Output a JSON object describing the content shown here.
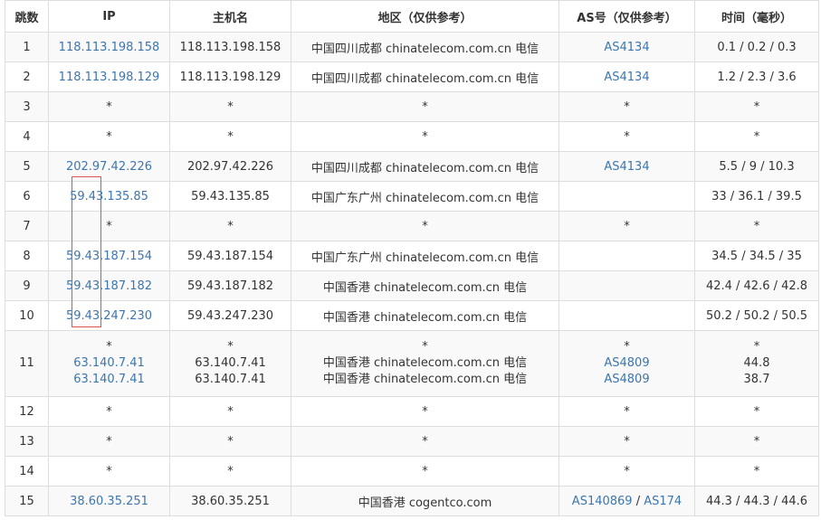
{
  "headers": [
    "跳数",
    "IP",
    "主机名",
    "地区（仅供参考）",
    "AS号（仅供参考）",
    "时间（毫秒）"
  ],
  "rows": [
    {
      "hop": "1",
      "ip": "118.113.198.158",
      "host": "118.113.198.158",
      "region": "中国四川成都 chinatelecom.com.cn 电信",
      "as": "AS4134",
      "time": "0.1 / 0.2 / 0.3"
    },
    {
      "hop": "2",
      "ip": "118.113.198.129",
      "host": "118.113.198.129",
      "region": "中国四川成都 chinatelecom.com.cn 电信",
      "as": "AS4134",
      "time": "1.2 / 2.3 / 3.6"
    },
    {
      "hop": "3",
      "ip": "*",
      "host": "*",
      "region": "*",
      "as": "*",
      "time": "*"
    },
    {
      "hop": "4",
      "ip": "*",
      "host": "*",
      "region": "*",
      "as": "*",
      "time": "*"
    },
    {
      "hop": "5",
      "ip": "202.97.42.226",
      "host": "202.97.42.226",
      "region": "中国四川成都 chinatelecom.com.cn 电信",
      "as": "AS4134",
      "time": "5.5 / 9 / 10.3"
    },
    {
      "hop": "6",
      "ip": "59.43.135.85",
      "host": "59.43.135.85",
      "region": "中国广东广州 chinatelecom.com.cn 电信",
      "as": "",
      "time": "33 / 36.1 / 39.5"
    },
    {
      "hop": "7",
      "ip": "*",
      "host": "*",
      "region": "*",
      "as": "*",
      "time": "*"
    },
    {
      "hop": "8",
      "ip": "59.43.187.154",
      "host": "59.43.187.154",
      "region": "中国广东广州 chinatelecom.com.cn 电信",
      "as": "",
      "time": "34.5 / 34.5 / 35"
    },
    {
      "hop": "9",
      "ip": "59.43.187.182",
      "host": "59.43.187.182",
      "region": "中国香港 chinatelecom.com.cn 电信",
      "as": "",
      "time": "42.4 / 42.6 / 42.8"
    },
    {
      "hop": "10",
      "ip": "59.43.247.230",
      "host": "59.43.247.230",
      "region": "中国香港 chinatelecom.com.cn 电信",
      "as": "",
      "time": "50.2 / 50.2 / 50.5"
    },
    {
      "hop": "11",
      "ip": [
        "*",
        "63.140.7.41",
        "63.140.7.41"
      ],
      "host": [
        "*",
        "63.140.7.41",
        "63.140.7.41"
      ],
      "region": [
        "*",
        "中国香港 chinatelecom.com.cn 电信",
        "中国香港 chinatelecom.com.cn 电信"
      ],
      "as": [
        "*",
        "AS4809",
        "AS4809"
      ],
      "time": [
        "*",
        "44.8",
        "38.7"
      ]
    },
    {
      "hop": "12",
      "ip": "*",
      "host": "*",
      "region": "*",
      "as": "*",
      "time": "*"
    },
    {
      "hop": "13",
      "ip": "*",
      "host": "*",
      "region": "*",
      "as": "*",
      "time": "*"
    },
    {
      "hop": "14",
      "ip": "*",
      "host": "*",
      "region": "*",
      "as": "*",
      "time": "*"
    },
    {
      "hop": "15",
      "ip": "38.60.35.251",
      "host": "38.60.35.251",
      "region": "中国香港 cogentco.com",
      "as": "AS140869",
      "as_sep": " / ",
      "as2": "AS174",
      "time": "44.3 / 44.3 / 44.6"
    }
  ],
  "colors": {
    "link": "#3b76b0",
    "border": "#dddddd",
    "stripe": "#f9f9f9",
    "highlight_box": "#d9534f"
  }
}
